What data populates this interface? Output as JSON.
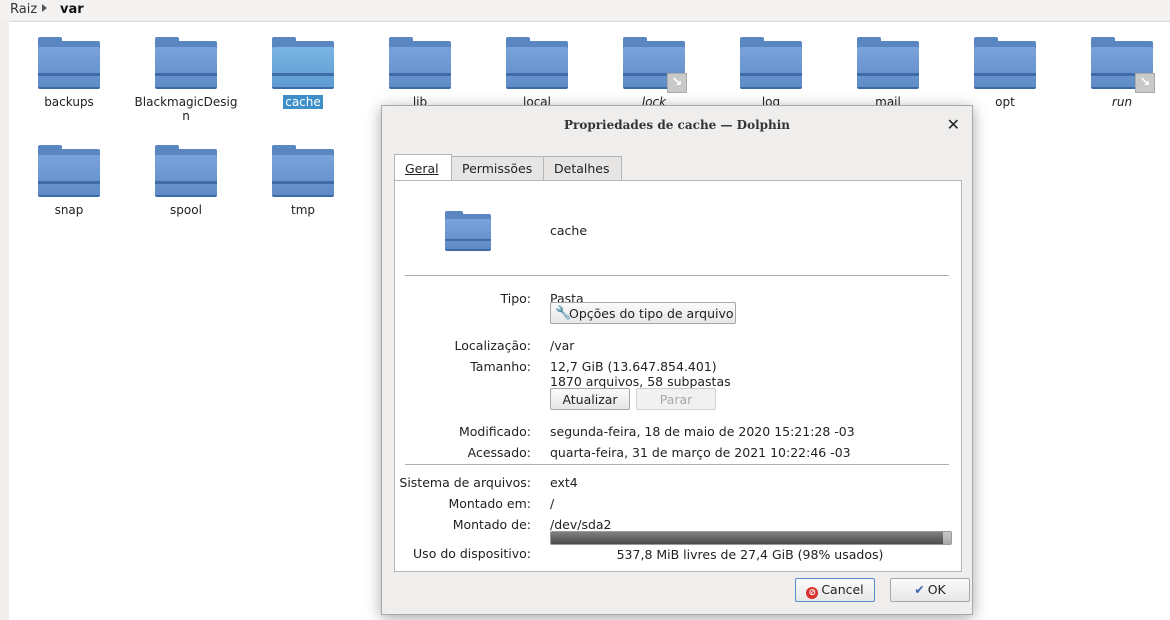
{
  "breadcrumb": {
    "root": "Raiz",
    "current": "var"
  },
  "files": [
    {
      "name": "backups"
    },
    {
      "name": "BlackmagicDesign"
    },
    {
      "name": "cache",
      "selected": true
    },
    {
      "name": "lib"
    },
    {
      "name": "local"
    },
    {
      "name": "lock",
      "symlink": true,
      "italic": true
    },
    {
      "name": "log"
    },
    {
      "name": "mail"
    },
    {
      "name": "opt"
    },
    {
      "name": "run",
      "symlink": true,
      "italic": true
    },
    {
      "name": "snap"
    },
    {
      "name": "spool"
    },
    {
      "name": "tmp"
    }
  ],
  "dialog": {
    "title": "Propriedades de cache — Dolphin",
    "close_icon": "close-icon",
    "tabs": [
      "Geral",
      "Permissões",
      "Detalhes"
    ],
    "name": "cache",
    "type_label": "Tipo:",
    "type_value": "Pasta",
    "file_type_options": "Opções do tipo de arquivo",
    "location_label": "Localização:",
    "location_value": "/var",
    "size_label": "Tamanho:",
    "size_value": "12,7 GiB (13.647.854.401)",
    "size_detail": "1870 arquivos, 58 subpastas",
    "refresh_button": "Atualizar",
    "stop_button": "Parar",
    "modified_label": "Modificado:",
    "modified_value": "segunda-feira, 18 de maio de 2020 15:21:28 -03",
    "accessed_label": "Acessado:",
    "accessed_value": "quarta-feira, 31 de março de 2021 10:22:46 -03",
    "fs_label": "Sistema de arquivos:",
    "fs_value": "ext4",
    "mounted_on_label": "Montado em:",
    "mounted_on_value": "/",
    "mounted_from_label": "Montado de:",
    "mounted_from_value": "/dev/sda2",
    "usage_label": "Uso do dispositivo:",
    "usage_text": "537,8 MiB livres de 27,4 GiB (98% usados)",
    "usage_fraction": 0.98,
    "cancel_button": "Cancel",
    "ok_button": "OK"
  }
}
